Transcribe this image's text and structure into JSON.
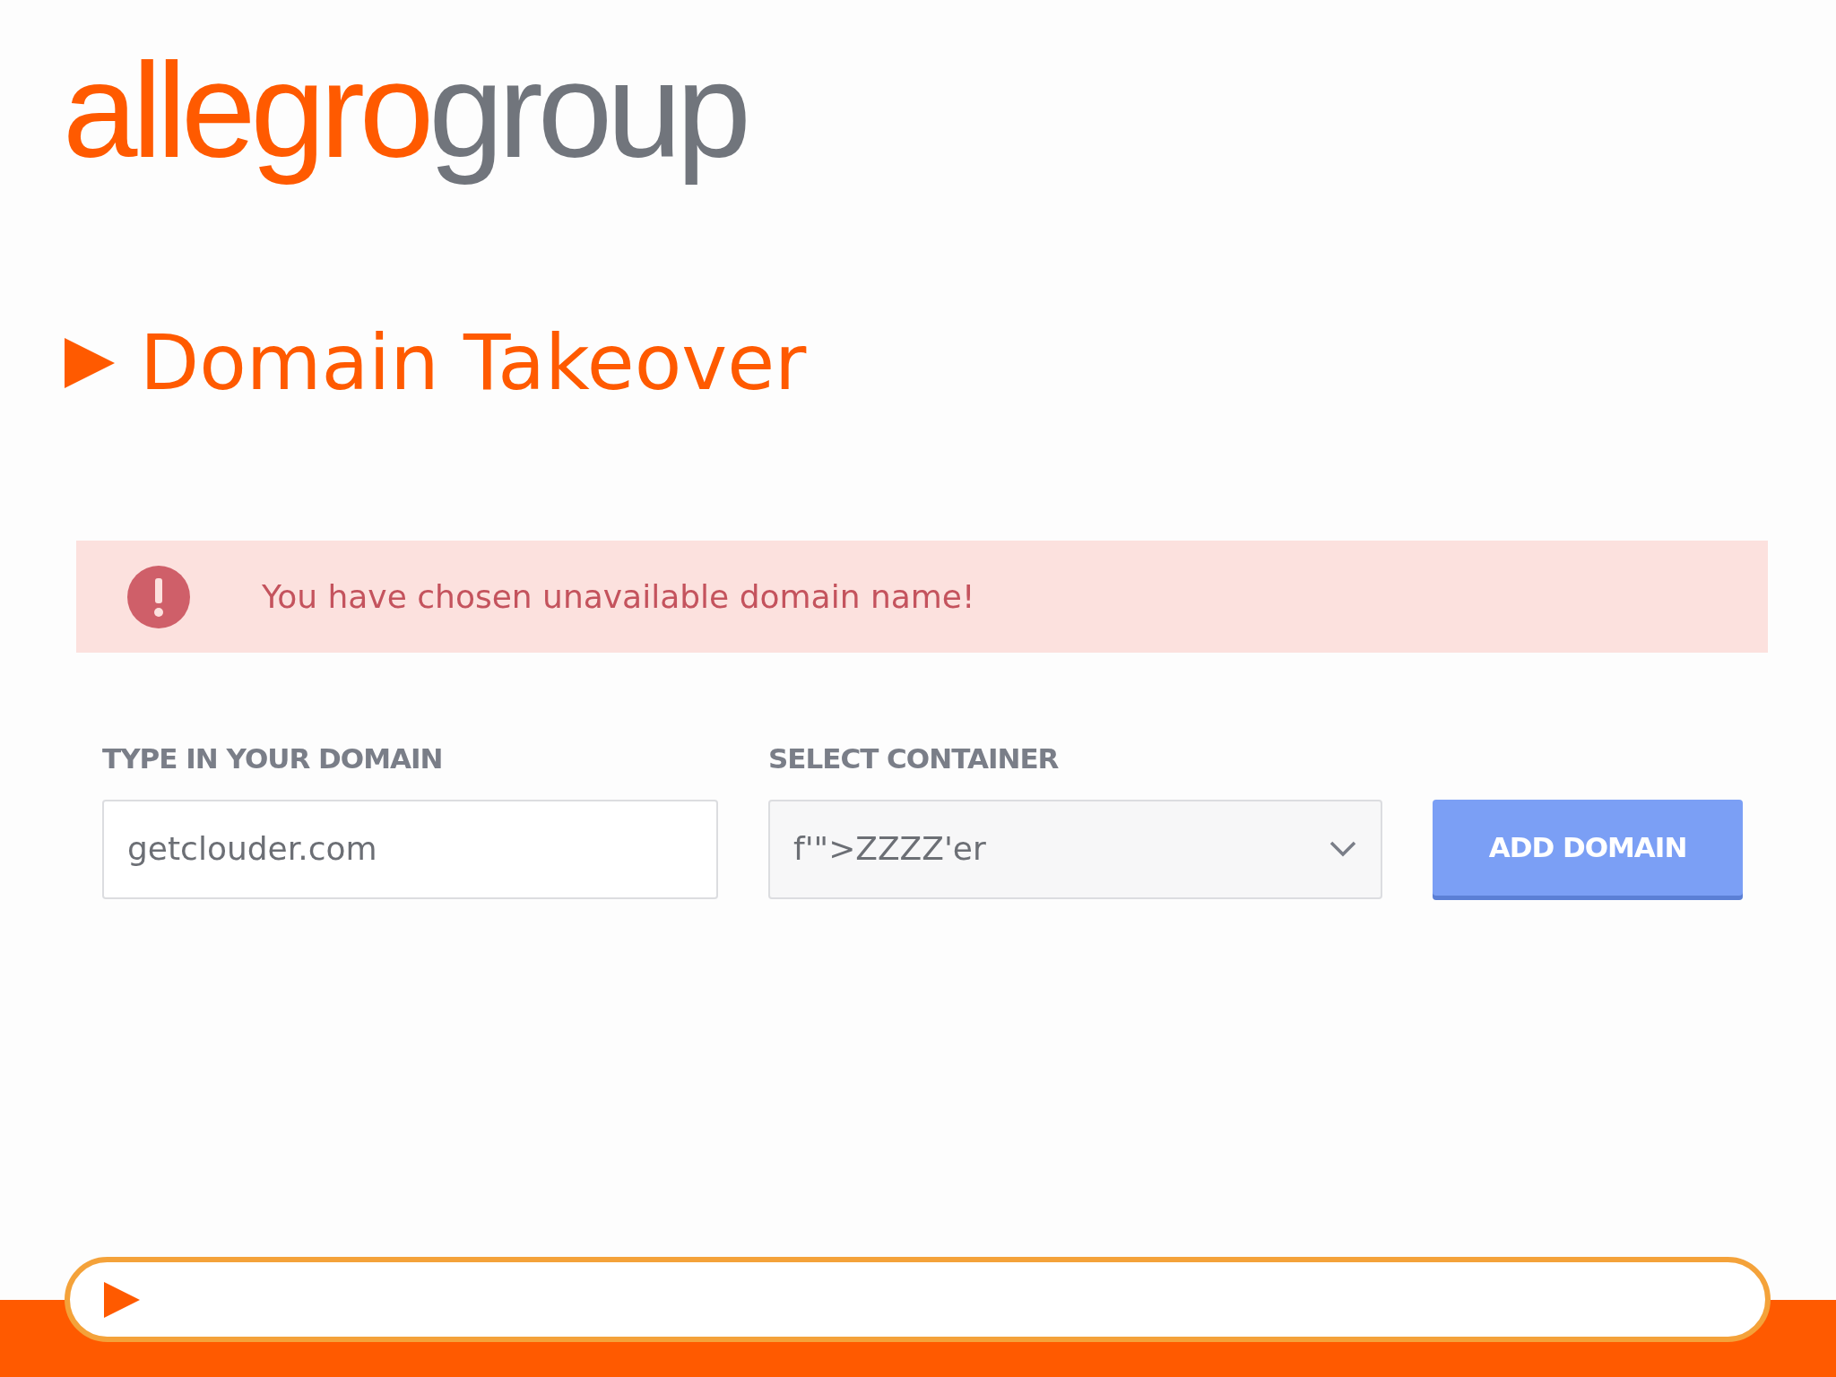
{
  "logo": {
    "primary": "allegro",
    "secondary": "group"
  },
  "title": "Domain Takeover",
  "alert": {
    "kind": "error",
    "message": "You have chosen unavailable domain name!"
  },
  "form": {
    "domain": {
      "label": "TYPE IN YOUR DOMAIN",
      "value": "getclouder.com"
    },
    "container": {
      "label": "SELECT CONTAINER",
      "value": "f'\">ZZZZ'er"
    },
    "button": "ADD DOMAIN"
  }
}
